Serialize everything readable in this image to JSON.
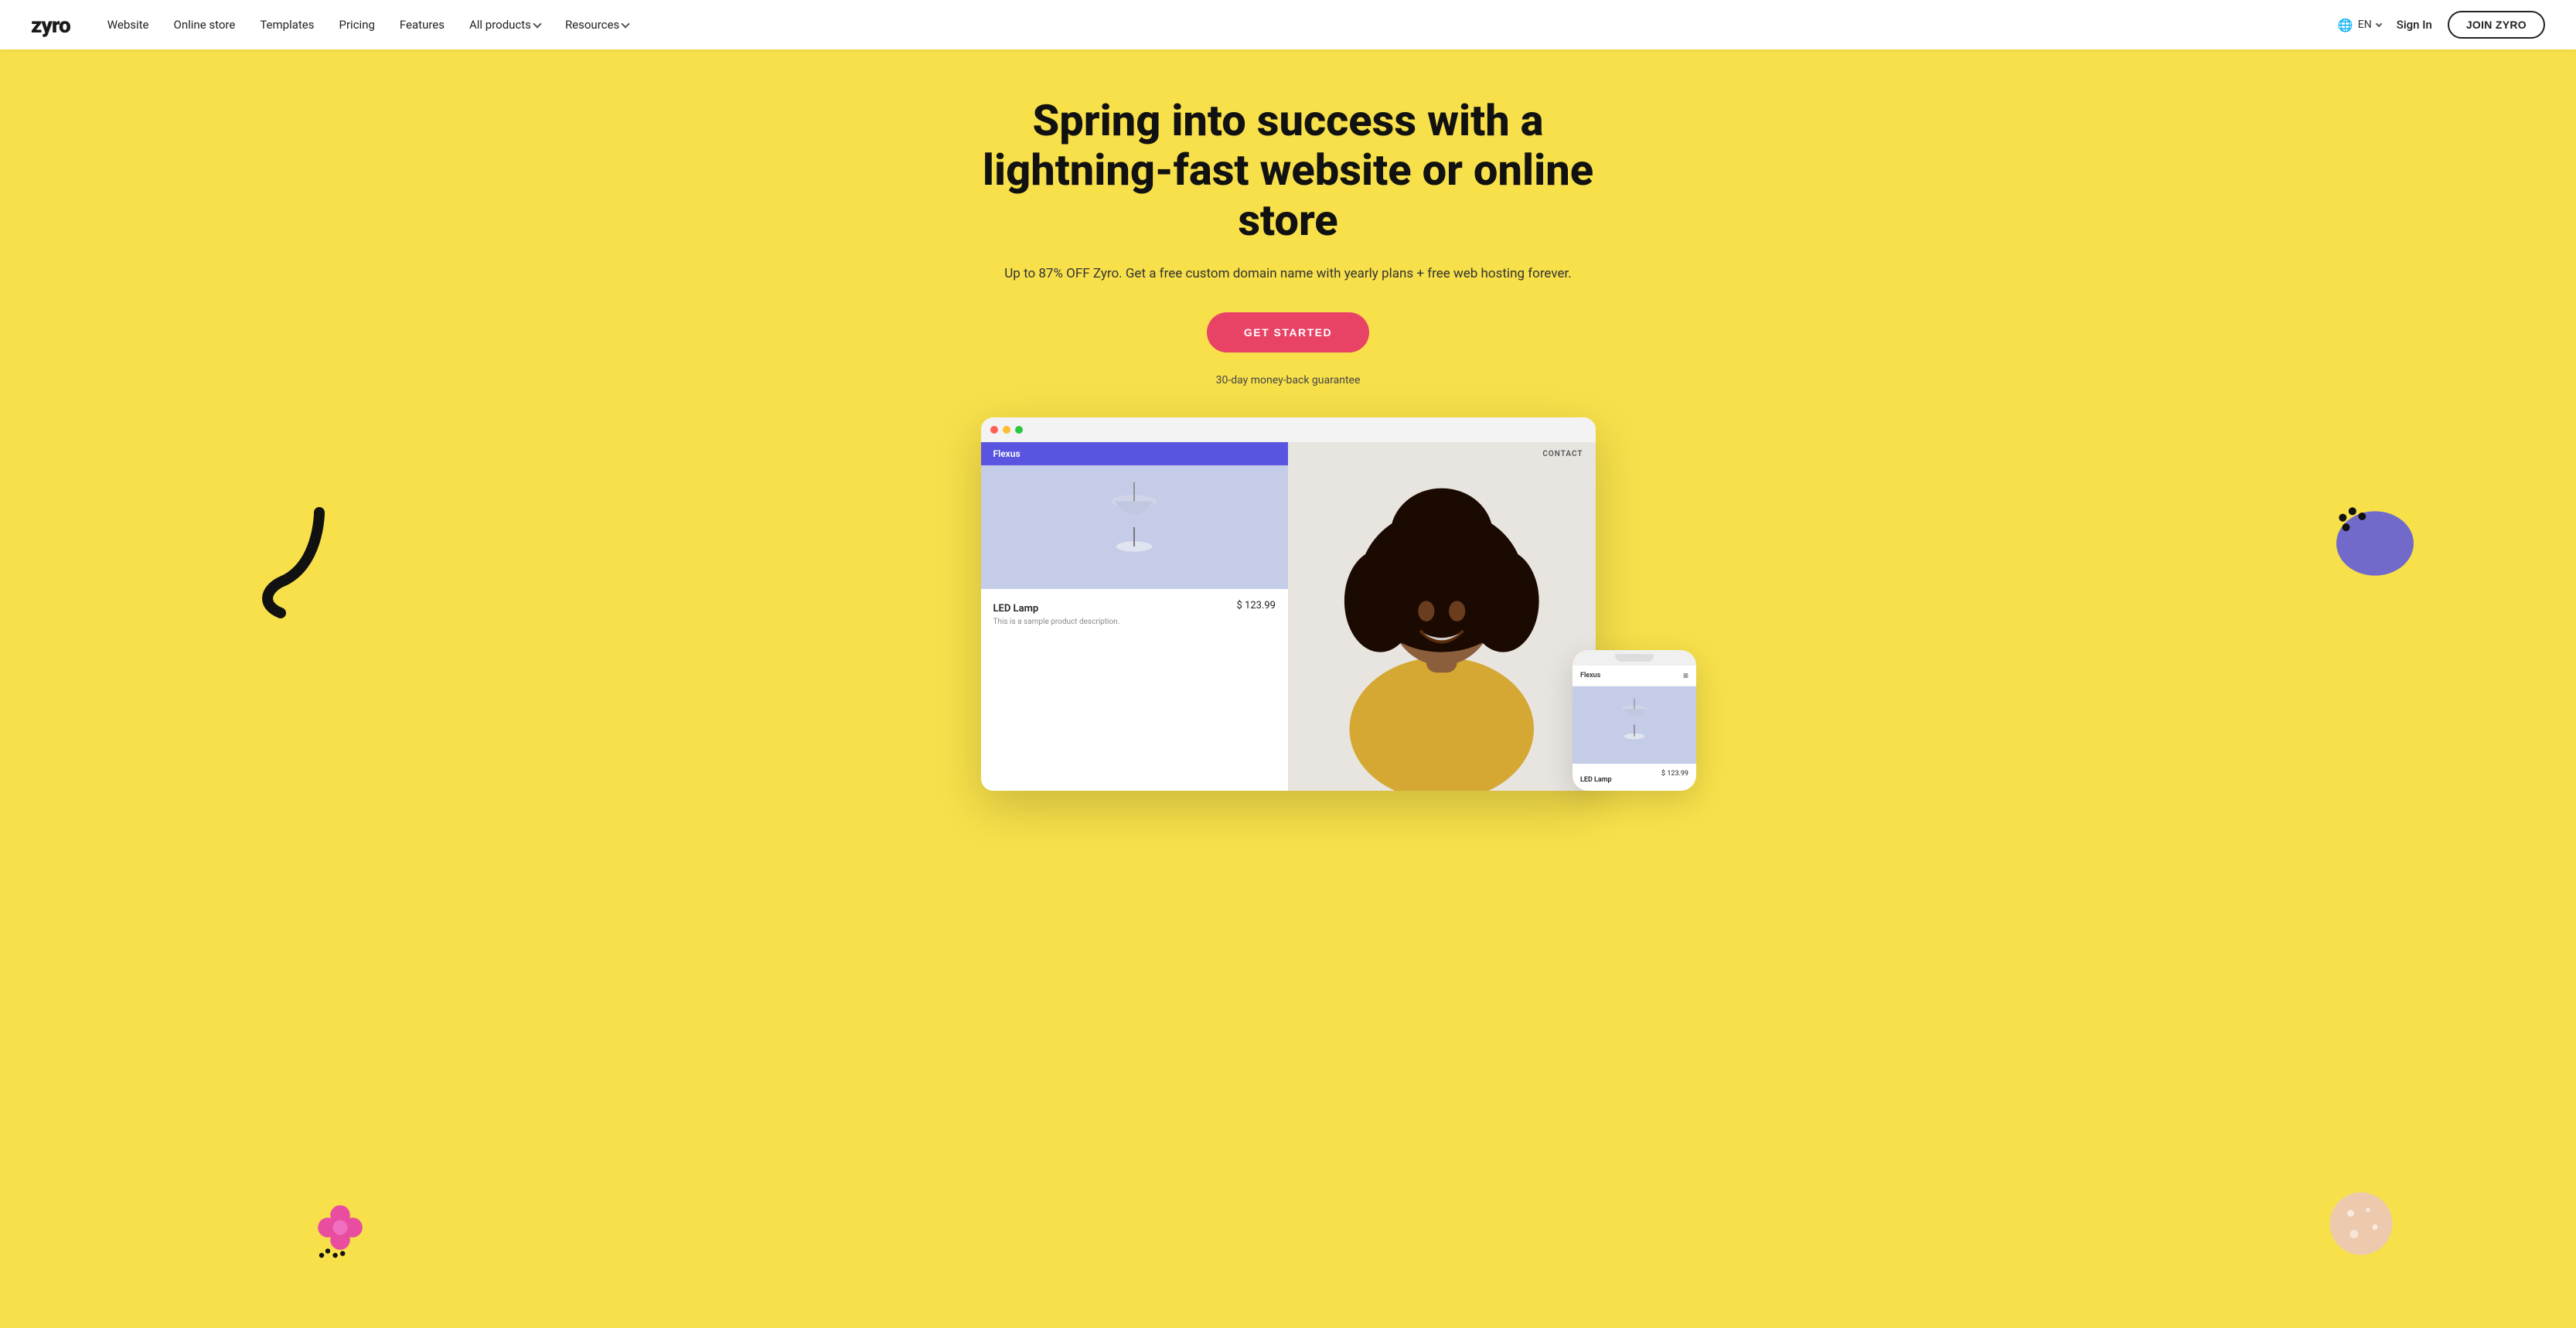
{
  "nav": {
    "logo": "zyro",
    "links": [
      {
        "id": "website",
        "label": "Website",
        "hasDropdown": false
      },
      {
        "id": "online-store",
        "label": "Online store",
        "hasDropdown": false
      },
      {
        "id": "templates",
        "label": "Templates",
        "hasDropdown": false
      },
      {
        "id": "pricing",
        "label": "Pricing",
        "hasDropdown": false
      },
      {
        "id": "features",
        "label": "Features",
        "hasDropdown": false
      },
      {
        "id": "all-products",
        "label": "All products",
        "hasDropdown": true
      },
      {
        "id": "resources",
        "label": "Resources",
        "hasDropdown": true
      }
    ],
    "lang": "EN",
    "signin": "Sign In",
    "join": "JOIN ZYRO"
  },
  "hero": {
    "title": "Spring into success with a lightning-fast website or online store",
    "subtitle": "Up to 87% OFF Zyro. Get a free custom domain name with yearly plans\n+ free web hosting forever.",
    "cta": "GET STARTED",
    "moneyBack": "30-day money-back guarantee"
  },
  "mockup": {
    "brand": "Flexus",
    "contact": "CONTACT",
    "product": {
      "name": "LED Lamp",
      "price": "$ 123.99",
      "description": "This is a sample product description."
    },
    "mobile": {
      "brand": "Flexus",
      "product": {
        "name": "LED Lamp",
        "price": "$ 123.99"
      }
    }
  }
}
